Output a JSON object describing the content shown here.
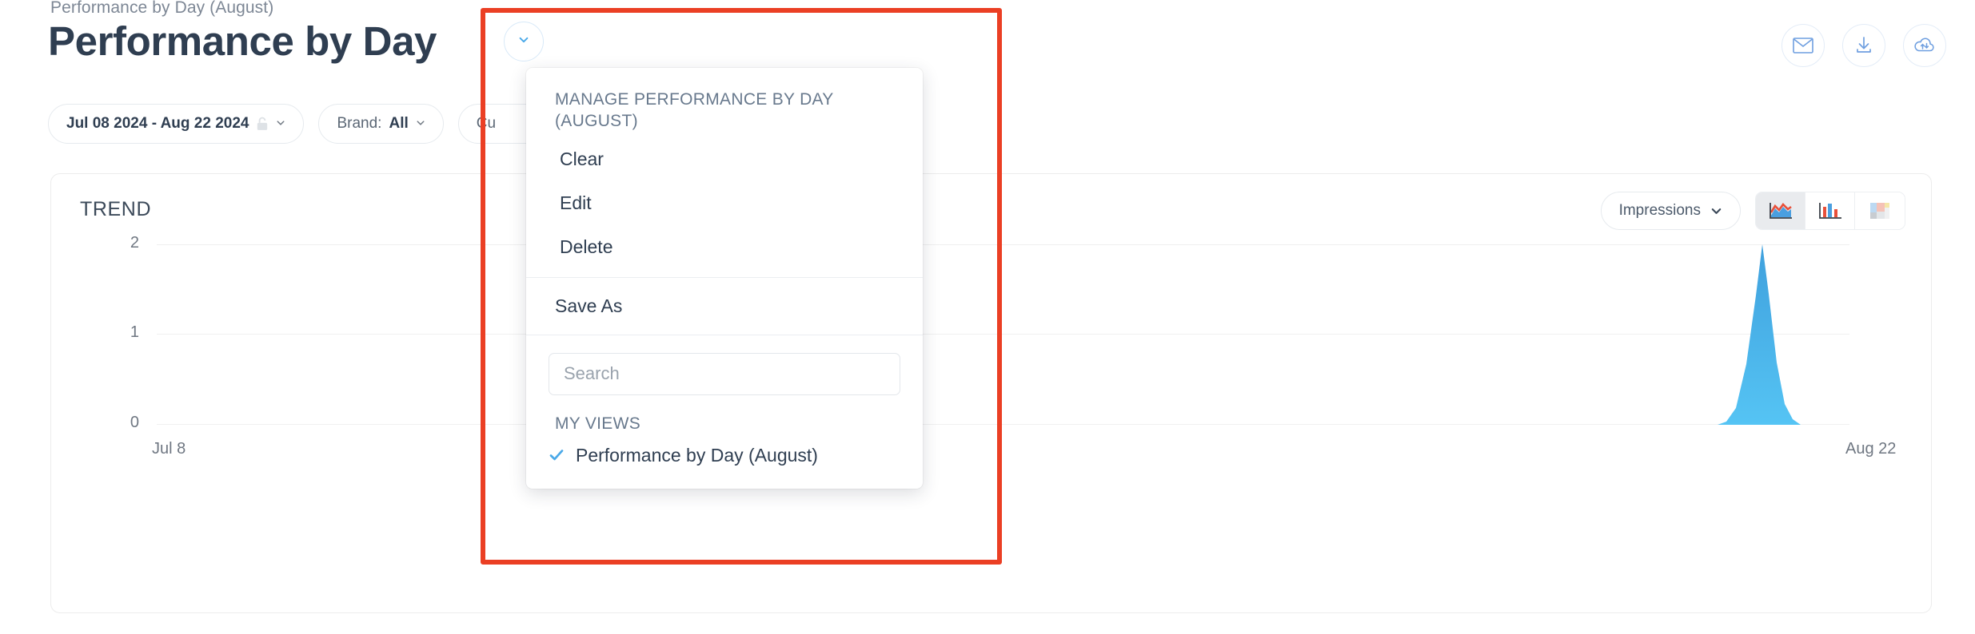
{
  "header": {
    "breadcrumb": "Performance by Day (August)",
    "title": "Performance by Day",
    "view_toggle_icon": "chevron-down-icon",
    "actions": [
      {
        "name": "email-button",
        "icon": "envelope-icon"
      },
      {
        "name": "download-button",
        "icon": "download-icon"
      },
      {
        "name": "cloud-sync-button",
        "icon": "cloud-sync-icon"
      }
    ]
  },
  "filters": {
    "date_range": "Jul 08 2024 - Aug 22 2024",
    "date_lock_icon": "unlock-icon",
    "brand_prefix": "Brand: ",
    "brand_value": "All",
    "third_filter_partial": "Cu",
    "search_icon": "search-icon"
  },
  "dropdown": {
    "manage_header": "MANAGE PERFORMANCE BY DAY (AUGUST)",
    "items": [
      {
        "label": "Clear",
        "name": "menu-item-clear"
      },
      {
        "label": "Edit",
        "name": "menu-item-edit"
      },
      {
        "label": "Delete",
        "name": "menu-item-delete"
      }
    ],
    "save_as": "Save As",
    "search_placeholder": "Search",
    "search_value": "",
    "group_label": "MY VIEWS",
    "views": [
      {
        "label": "Performance by Day (August)",
        "selected": true
      }
    ]
  },
  "trend_card": {
    "title": "TREND",
    "metric_selected": "Impressions",
    "chart_types": [
      {
        "name": "area-chart-toggle",
        "active": true
      },
      {
        "name": "bar-chart-toggle",
        "active": false
      },
      {
        "name": "treemap-chart-toggle",
        "active": false
      }
    ]
  },
  "colors": {
    "accent_blue": "#4aa9e8",
    "highlight_red": "#eb3f24",
    "title_navy": "#2f3e51",
    "muted_gray": "#6f7782"
  },
  "chart_data": {
    "type": "area",
    "title": "TREND",
    "metric": "Impressions",
    "xlabel": "",
    "ylabel": "",
    "ylim": [
      0,
      2
    ],
    "yticks": [
      0,
      1,
      2
    ],
    "grid": true,
    "legend": "none",
    "x_tick_labels": [
      "Jul 8",
      "Aug 22"
    ],
    "x_range": [
      "Jul 8",
      "Aug 22"
    ],
    "series": [
      {
        "name": "Impressions",
        "color": "#4aa9e8",
        "x": [
          "Jul 8",
          "Aug 16",
          "Aug 18",
          "Aug 20",
          "Aug 21",
          "Aug 22"
        ],
        "values": [
          0,
          0,
          0,
          0.28,
          1.1,
          2
        ]
      }
    ]
  }
}
